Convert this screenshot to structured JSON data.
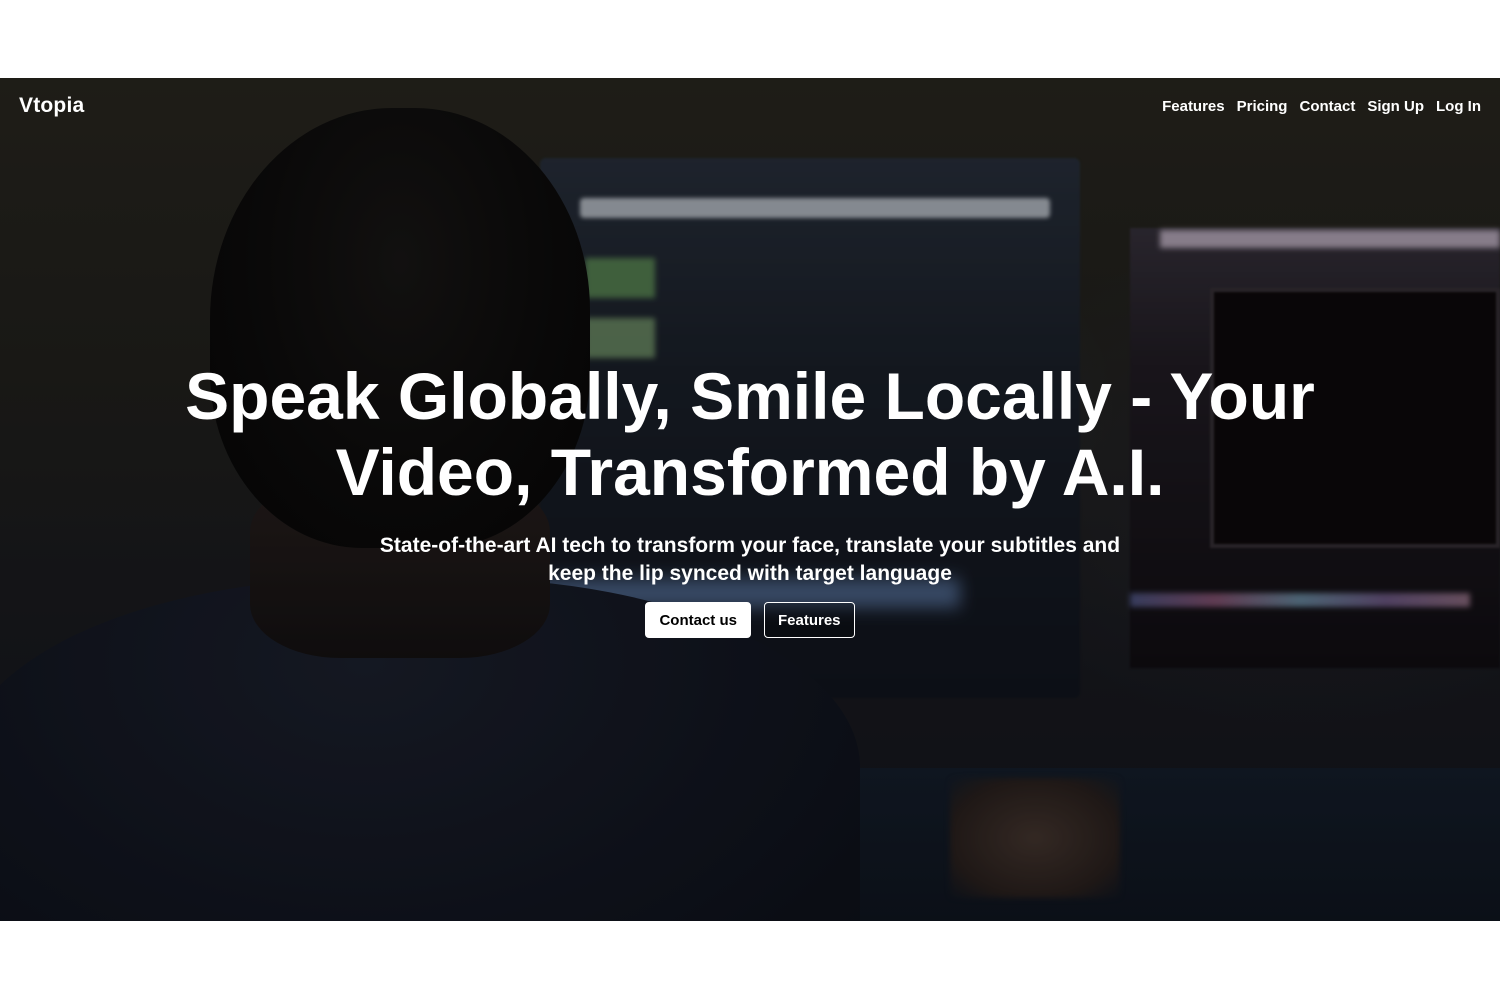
{
  "nav": {
    "logo": "Vtopia",
    "links": [
      "Features",
      "Pricing",
      "Contact",
      "Sign Up",
      "Log In"
    ]
  },
  "hero": {
    "headline": "Speak Globally, Smile Locally - Your Video, Transformed by A.I.",
    "subheadline": "State-of-the-art AI tech to transform your face, translate your subtitles and keep the lip synced with target language",
    "primary_button": "Contact us",
    "secondary_button": "Features"
  },
  "colors": {
    "text": "#ffffff",
    "primary_button_bg": "#ffffff",
    "primary_button_text": "#000000"
  }
}
